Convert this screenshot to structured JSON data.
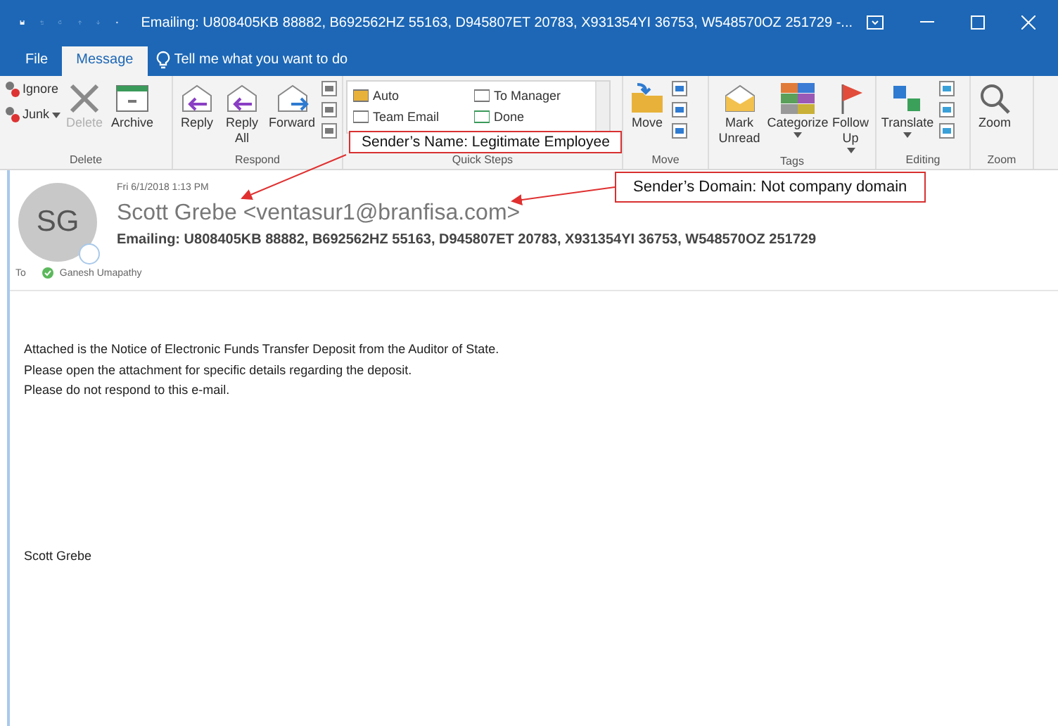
{
  "window": {
    "title": "Emailing: U808405KB 88882, B692562HZ 55163, D945807ET 20783, X931354YI   36753, W548570OZ 251729 -..."
  },
  "menu_tabs": [
    {
      "label": "File",
      "selected": false
    },
    {
      "label": "Message",
      "selected": true
    }
  ],
  "tell_me": {
    "placeholder": "Tell me what you want to do"
  },
  "ribbon": [
    {
      "label": "Delete",
      "items": [
        {
          "kind": "small",
          "label": "Ignore",
          "disabled": false,
          "menu": false
        },
        {
          "kind": "small",
          "label": "Junk",
          "disabled": false,
          "menu": true
        },
        {
          "kind": "large",
          "label": "Delete",
          "disabled": true,
          "menu": false
        },
        {
          "kind": "large",
          "label": "Archive",
          "disabled": false,
          "menu": false
        }
      ]
    },
    {
      "label": "Respond",
      "items": [
        {
          "kind": "large",
          "label": "Reply",
          "disabled": false,
          "menu": false
        },
        {
          "kind": "large",
          "label": "Reply All",
          "disabled": false,
          "menu": false
        },
        {
          "kind": "large",
          "label": "Forward",
          "disabled": false,
          "menu": false
        },
        {
          "kind": "stack"
        }
      ]
    },
    {
      "label": "Quick Steps",
      "items": [
        {
          "kind": "gallery",
          "entries": [
            "Auto",
            "Team Email",
            "To Manager",
            "Done"
          ]
        }
      ]
    },
    {
      "label": "Move",
      "items": [
        {
          "kind": "large",
          "label": "Move",
          "disabled": false,
          "menu": false
        },
        {
          "kind": "stack"
        }
      ]
    },
    {
      "label": "Tags",
      "items": [
        {
          "kind": "large",
          "label": "Mark Unread",
          "disabled": false,
          "menu": false
        },
        {
          "kind": "large",
          "label": "Categorize",
          "disabled": false,
          "menu": true
        },
        {
          "kind": "large",
          "label": "Follow Up",
          "disabled": false,
          "menu": true
        }
      ]
    },
    {
      "label": "Editing",
      "items": [
        {
          "kind": "large",
          "label": "Translate",
          "disabled": false,
          "menu": true
        },
        {
          "kind": "stack"
        }
      ]
    },
    {
      "label": "Zoom",
      "items": [
        {
          "kind": "large",
          "label": "Zoom",
          "disabled": false,
          "menu": false
        }
      ]
    }
  ],
  "message": {
    "avatar": "SG",
    "date": "Fri 6/1/2018 1:13 PM",
    "sender_name": "Scott Grebe",
    "sender_email": "<ventasur1@branfisa.com>",
    "subject": "Emailing: U808405KB 88882, B692562HZ 55163, D945807ET 20783, X931354YI   36753, W548570OZ 251729",
    "to_label": "To",
    "recipient": "Ganesh Umapathy",
    "body": [
      "Attached is the Notice of Electronic Funds Transfer Deposit from the Auditor of State.",
      "Please open the attachment for specific details regarding the deposit.",
      "Please do not respond to this e-mail."
    ],
    "signature": "Scott Grebe"
  },
  "annotations": [
    {
      "text": "Sender’s Name: Legitimate Employee"
    },
    {
      "text": "Sender’s Domain: Not company domain"
    }
  ]
}
